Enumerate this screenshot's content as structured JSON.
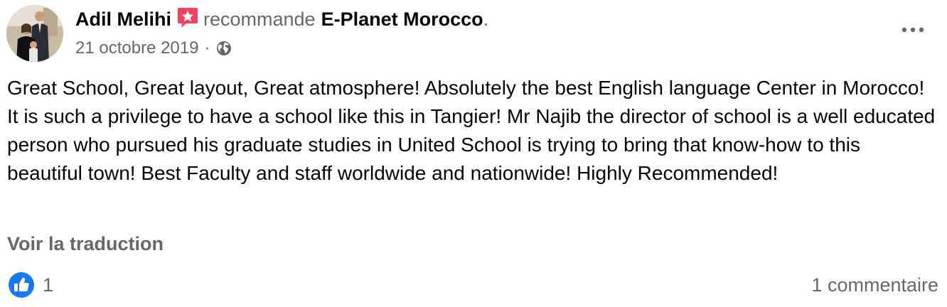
{
  "post": {
    "author": "Adil Melihi",
    "verb": "recommande",
    "page": "E-Planet Morocco",
    "period": ".",
    "date": "21 octobre 2019",
    "separator": "·",
    "audience_icon": "globe-icon",
    "recommend_icon": "recommendation-star-icon",
    "more_icon": "more-options-icon",
    "body": "Great School, Great layout, Great atmosphere! Absolutely the best English language Center in Morocco! It is such a privilege to have a school like this in Tangier! Mr Najib the director of school is a well educated person who pursued his graduate studies in United School is trying to bring that know-how to this beautiful town! Best Faculty and staff worldwide and nationwide! Highly Recommended!",
    "translate_label": "Voir la traduction",
    "reaction_icon": "like-icon",
    "reaction_count": "1",
    "comments_label": "1 commentaire"
  },
  "colors": {
    "text_primary": "#050505",
    "text_secondary": "#65676b",
    "like_blue": "#1877f2",
    "recommend_pink": "#f3425f"
  }
}
